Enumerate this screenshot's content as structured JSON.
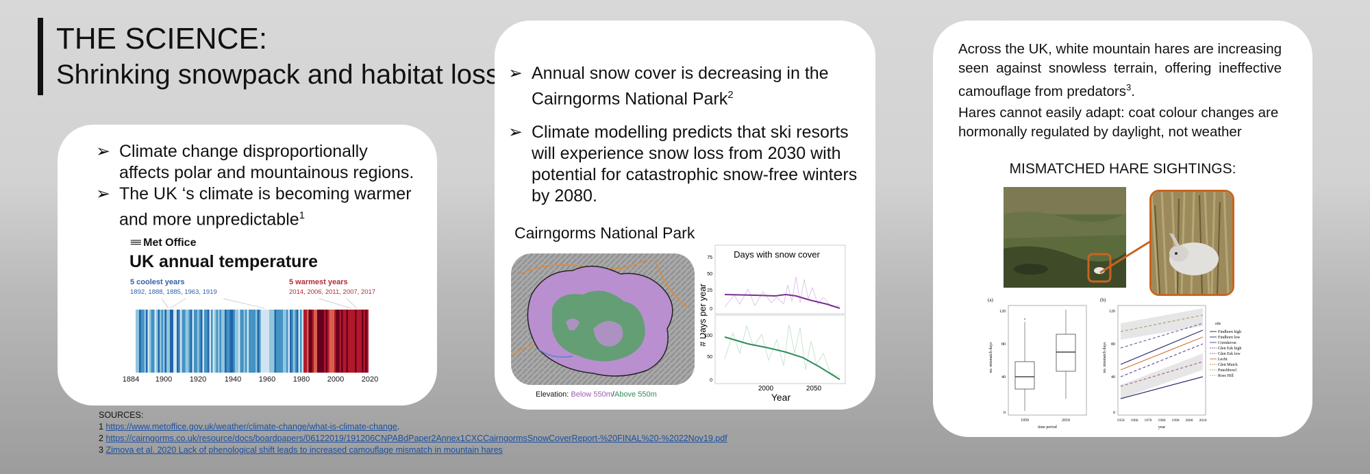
{
  "title": {
    "line1": "THE SCIENCE:",
    "line2": "Shrinking snowpack and habitat loss"
  },
  "left_card": {
    "bullets": [
      {
        "text": "Climate change disproportionally affects polar and mountainous regions.",
        "sup": ""
      },
      {
        "text": "The UK ‘s climate is becoming warmer and more unpredictable",
        "sup": "1"
      }
    ],
    "metoffice": {
      "logo": "Met Office",
      "title": "UK annual temperature",
      "coolest_heading": "5 coolest years",
      "coolest_years": "1892, 1888, 1885, 1963, 1919",
      "warmest_heading": "5 warmest years",
      "warmest_years": "2014, 2006, 2011, 2007, 2017",
      "tick_labels": [
        "1884",
        "1900",
        "1920",
        "1940",
        "1960",
        "1980",
        "2000",
        "2020"
      ],
      "colors": {
        "cool": "#2f5fa6",
        "warm": "#b22b33"
      }
    }
  },
  "mid_card": {
    "bullets": [
      {
        "text": "Annual snow cover is decreasing in the Cairngorms National Park",
        "sup": "2"
      },
      {
        "text": "Climate modelling predicts that ski resorts will experience snow loss from 2030 with potential for catastrophic snow-free winters by 2080.",
        "sup": ""
      }
    ],
    "map_title": "Cairngorms National Park",
    "legend": {
      "prefix": "Elevation:",
      "below": "Below 550m",
      "separator": "/",
      "above": "Above 550m",
      "below_color": "#9b59b6",
      "above_color": "#2e8b57"
    },
    "snow_chart": {
      "title": "Days with snow cover",
      "ylabel": "# Days per year",
      "xlabel": "Year",
      "x_ticks": [
        "2000",
        "2050"
      ],
      "top_y_ticks": [
        "75",
        "50",
        "25",
        "0"
      ],
      "bottom_y_ticks": [
        "100",
        "50",
        "0"
      ]
    }
  },
  "right_card": {
    "para1": "Across the UK, white mountain hares are increasing seen against snowless terrain, offering ineffective camouflage from predators",
    "para1_sup": "3",
    "para1_end": ".",
    "para2": "Hares cannot easily adapt: coat colour changes are hormonally regulated by daylight, not weather",
    "mismatch_title": "MISMATCHED HARE SIGHTINGS:",
    "plots": {
      "panel_a": "(a)",
      "panel_b": "(b)",
      "ylabel": "no. mismatch days",
      "a_xlabel": "time period",
      "b_xlabel": "year",
      "a_x_ticks": [
        "1950",
        "2010"
      ],
      "b_x_ticks": [
        "1950",
        "1960",
        "1970",
        "1980",
        "1990",
        "2000",
        "2010"
      ],
      "y_ticks": [
        "120",
        "80",
        "40",
        "0"
      ],
      "legend_title": "site",
      "sites": [
        "Findhorn high",
        "Findhorn low",
        "Corndavon",
        "Glen Esk high",
        "Glen Esk low",
        "Lecht",
        "Glen Muick",
        "Punchbowl",
        "Rose Hill"
      ]
    }
  },
  "sources": {
    "heading": "SOURCES:",
    "items": [
      {
        "num": "1",
        "link": "https://www.metoffice.gov.uk/weather/climate-change/what-is-climate-change",
        "after": "."
      },
      {
        "num": "2",
        "link": "https://cairngorms.co.uk/resource/docs/boardpapers/06122019/191206CNPABdPaper2Annex1CXCCairngormsSnowCoverReport-%20FINAL%20-%2022Nov19.pdf",
        "after": ""
      },
      {
        "num": "3",
        "link": "Zimova et al. 2020 Lack of phenological shift leads to increased camouflage mismatch in mountain hares",
        "after": ""
      }
    ]
  }
}
